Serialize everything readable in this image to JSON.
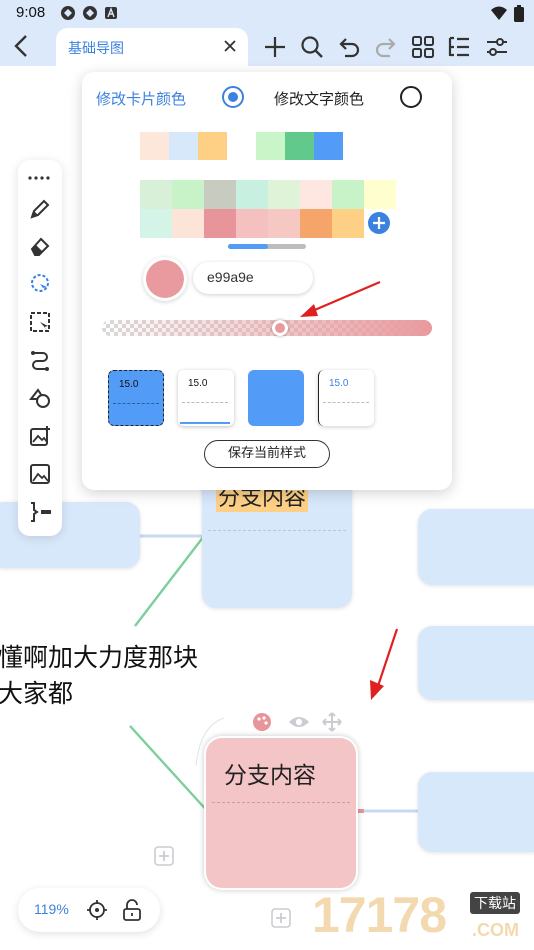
{
  "status_bar": {
    "time": "9:08"
  },
  "toolbar": {
    "doc_title": "基础导图",
    "icons": [
      "back-icon",
      "close-icon",
      "plus-icon",
      "search-icon",
      "undo-icon",
      "redo-icon",
      "grid-icon",
      "outline-icon",
      "settings-sliders-icon"
    ]
  },
  "popup": {
    "card_color_label": "修改卡片颜色",
    "text_color_label": "修改文字颜色",
    "selected_option": "card",
    "recent_colors_a": [
      "#fde7da",
      "#d8e8fb",
      "#fdd086"
    ],
    "recent_colors_b": [
      "#c9f5c9",
      "#62c98c",
      "#529bf6"
    ],
    "palette_row1": [
      "#d8efd8",
      "#c8f3c8",
      "#c8ccc0",
      "#c8f0e0",
      "#dff3d8",
      "#fde7e0",
      "#c8f3c8",
      "#fefecf"
    ],
    "palette_row2": [
      "#d4f4e8",
      "#fde4d8",
      "#e7959a",
      "#f5c0c0",
      "#f5c8c4",
      "#f5a46a",
      "#fdd086"
    ],
    "current_color": "#e99a9e",
    "hex_value": "e99a9e",
    "opacity": 0.54,
    "style_cards": [
      {
        "label": "15.0",
        "bg": "#529bf6",
        "text_color": "#111111"
      },
      {
        "label": "15.0",
        "bg": "#ffffff",
        "text_color": "#111111"
      },
      {
        "label": "",
        "bg": "#529bf6",
        "text_color": "#111111"
      },
      {
        "label": "15.0",
        "bg": "#ffffff",
        "text_color": "#3b82e0"
      }
    ],
    "save_label": "保存当前样式"
  },
  "canvas": {
    "upper_node_text": "分支内容",
    "selected_node_text": "分支内容",
    "free_text_line1": "懂啊加大力度那块",
    "free_text_line2": "大家都"
  },
  "zoom": {
    "level": "119%"
  },
  "watermark": {
    "number": "17178",
    "caption": "下载站",
    "domain": ".COM"
  }
}
